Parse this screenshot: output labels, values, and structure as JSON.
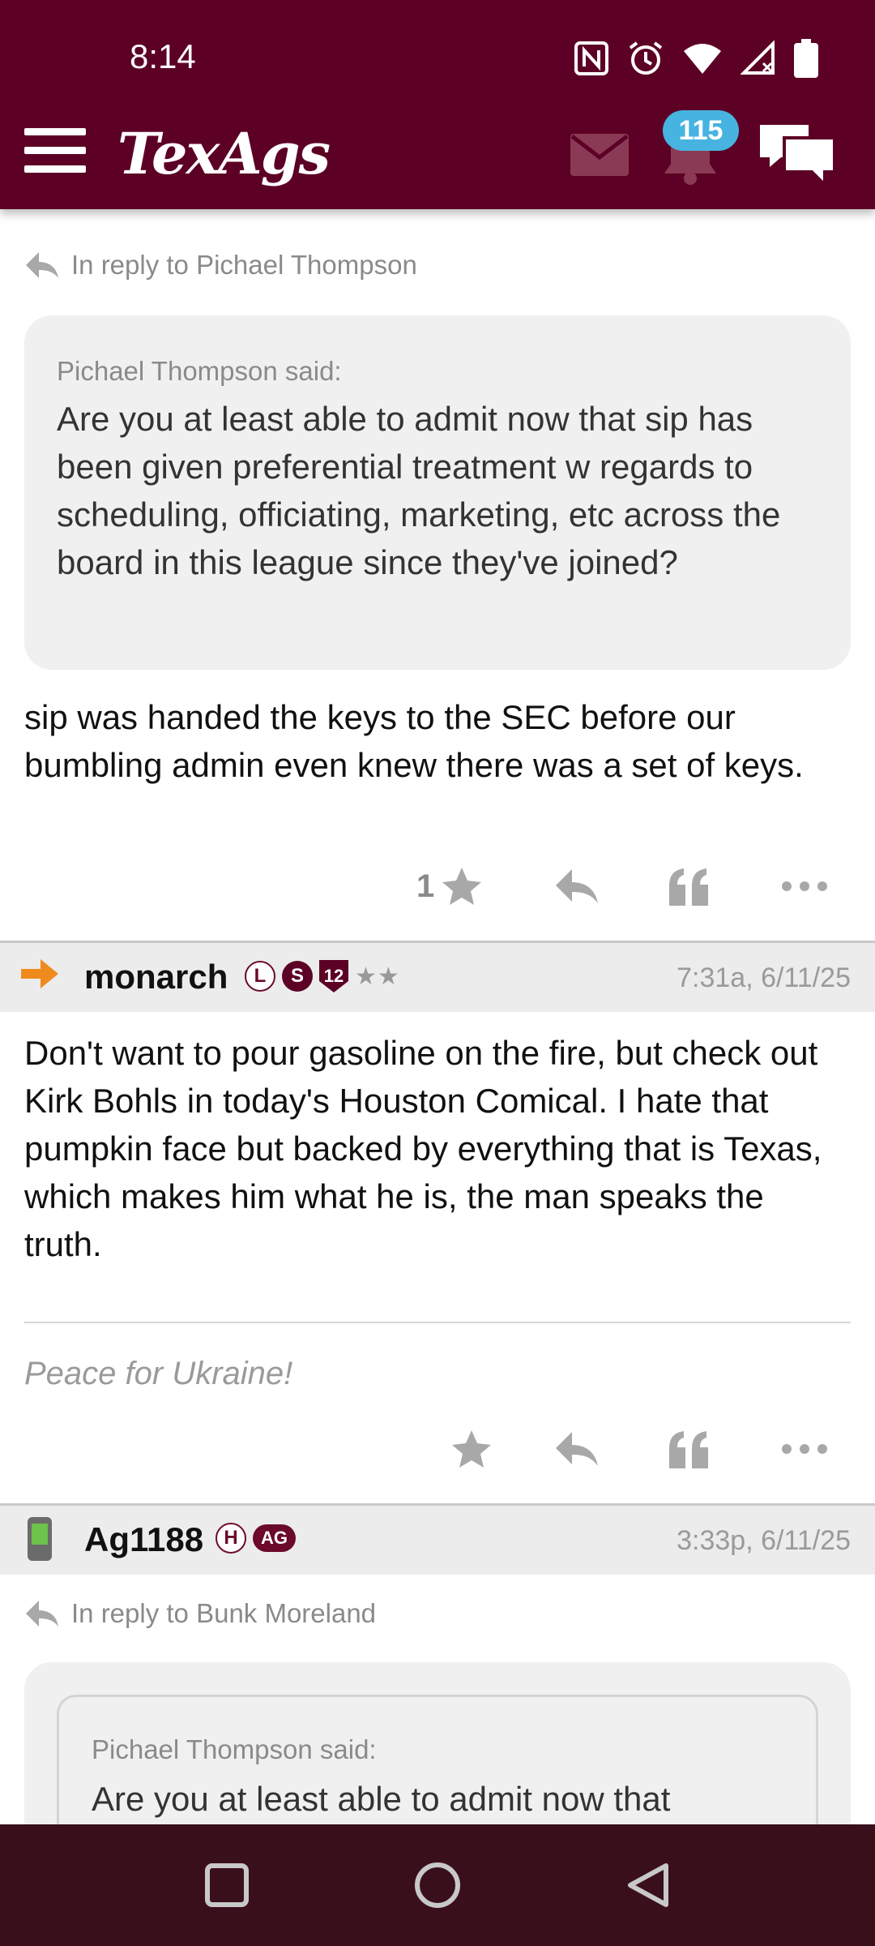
{
  "status_bar": {
    "time": "8:14"
  },
  "header": {
    "brand": "TexAgs",
    "notification_count": "115"
  },
  "posts": [
    {
      "reply_to": "In reply to Pichael Thompson",
      "quote": {
        "author": "Pichael Thompson said:",
        "text": "Are you at least able to admit now that sip has been given preferential treatment w regards to scheduling, officiating, marketing, etc across the board in this league since they've joined?"
      },
      "body": "sip was handed the keys to the SEC before our bumbling admin even knew there was a set of keys.",
      "star_count": "1"
    },
    {
      "username": "monarch",
      "badges": [
        "L",
        "S",
        "12"
      ],
      "rank_stars": "★★",
      "time": "7:31a, 6/11/25",
      "body": "Don't want to pour gasoline on the fire, but check out Kirk Bohls in today's Houston Comical. I hate that pumpkin face but backed by everything that is Texas, which makes him what he is, the man speaks the truth.",
      "signature": "Peace for Ukraine!",
      "star_count": ""
    },
    {
      "username": "Ag1188",
      "badges": [
        "H",
        "AG"
      ],
      "time": "3:33p, 6/11/25",
      "reply_to": "In reply to Bunk Moreland",
      "quote": {
        "author": "Pichael Thompson said:",
        "text": "Are you at least able to admit now that"
      }
    }
  ],
  "colors": {
    "brand": "#5c0025",
    "badge": "#47b3e0",
    "navbar": "#3a0f1c"
  },
  "icons": [
    "menu-icon",
    "mail-icon",
    "bell-icon",
    "chat-icon",
    "reply-arrow-icon",
    "star-icon",
    "reply-icon",
    "quote-icon",
    "more-icon",
    "arrow-icon",
    "phone-icon"
  ]
}
